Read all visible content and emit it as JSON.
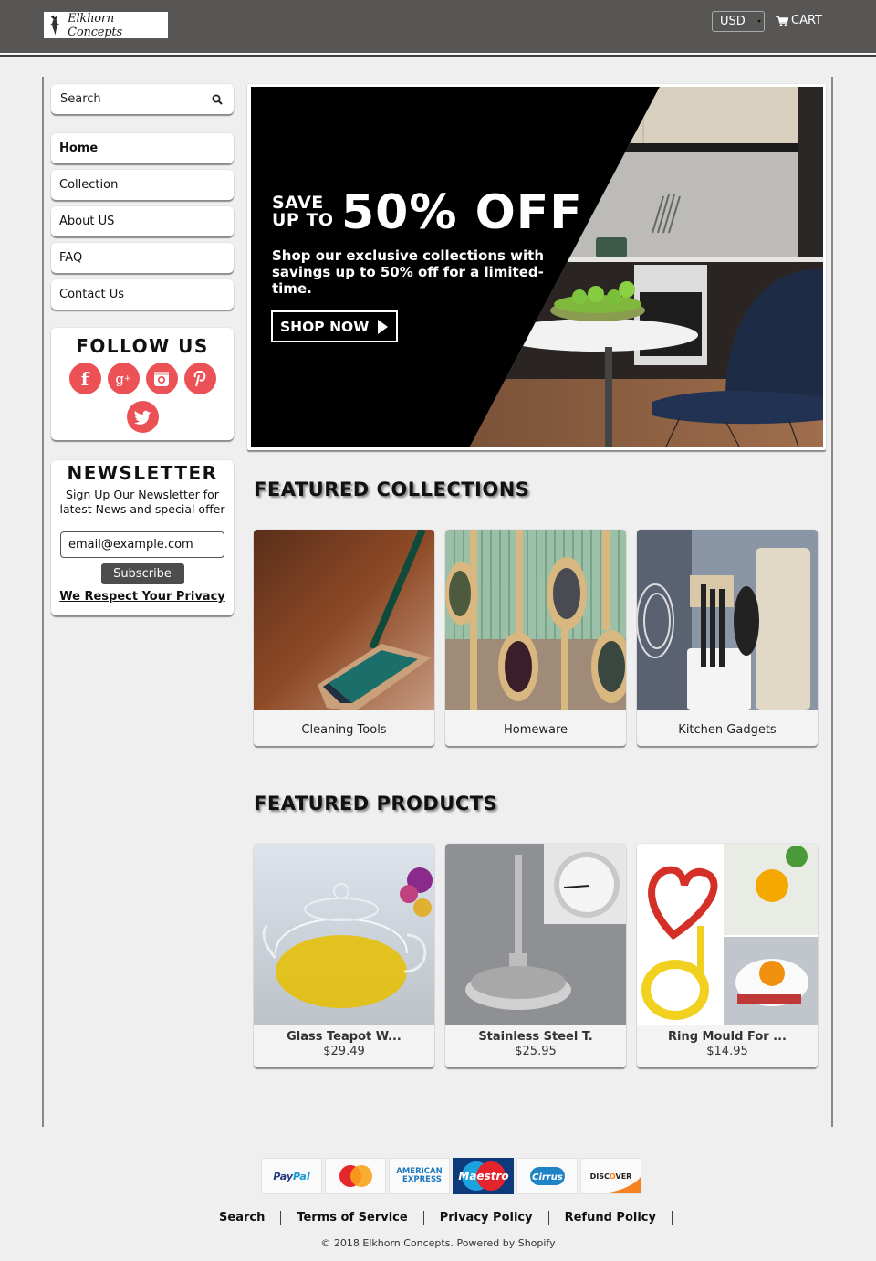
{
  "header": {
    "logo_text": "Elkhorn Concepts",
    "currency": "USD",
    "cart_label": "CART"
  },
  "sidebar": {
    "search_placeholder": "Search",
    "nav": [
      {
        "label": "Home",
        "active": true
      },
      {
        "label": "Collection"
      },
      {
        "label": "About US"
      },
      {
        "label": "FAQ"
      },
      {
        "label": "Contact Us"
      }
    ],
    "follow": {
      "title": "FOLLOW US",
      "icons": [
        "facebook-icon",
        "google-plus-icon",
        "instagram-icon",
        "pinterest-icon",
        "twitter-icon"
      ],
      "color": "#ec5156"
    },
    "newsletter": {
      "title": "NEWSLETTER",
      "text": "Sign Up Our Newsletter for latest News and special offer",
      "email_value": "email@example.com",
      "subscribe_label": "Subscribe",
      "privacy_label": "We Respect Your Privacy"
    }
  },
  "hero": {
    "save_line1": "SAVE",
    "save_line2": "UP TO",
    "headline": "50% OFF",
    "subtext": "Shop our exclusive collections with savings up to 50% off for a limited-time.",
    "cta": "SHOP NOW"
  },
  "featured_collections": {
    "title": "FEATURED COLLECTIONS",
    "items": [
      {
        "label": "Cleaning Tools"
      },
      {
        "label": "Homeware"
      },
      {
        "label": "Kitchen Gadgets"
      }
    ]
  },
  "featured_products": {
    "title": "FEATURED PRODUCTS",
    "items": [
      {
        "name": "Glass Teapot W...",
        "price": "$29.49"
      },
      {
        "name": "Stainless Steel T.",
        "price": "$25.95"
      },
      {
        "name": "Ring Mould For ...",
        "price": "$14.95"
      }
    ]
  },
  "footer": {
    "payments": [
      "PayPal",
      "MasterCard",
      "American Express",
      "Maestro",
      "Cirrus",
      "Discover"
    ],
    "links": [
      "Search",
      "Terms of Service",
      "Privacy Policy",
      "Refund Policy"
    ],
    "copyright": "© 2018 Elkhorn Concepts. Powered by Shopify"
  }
}
